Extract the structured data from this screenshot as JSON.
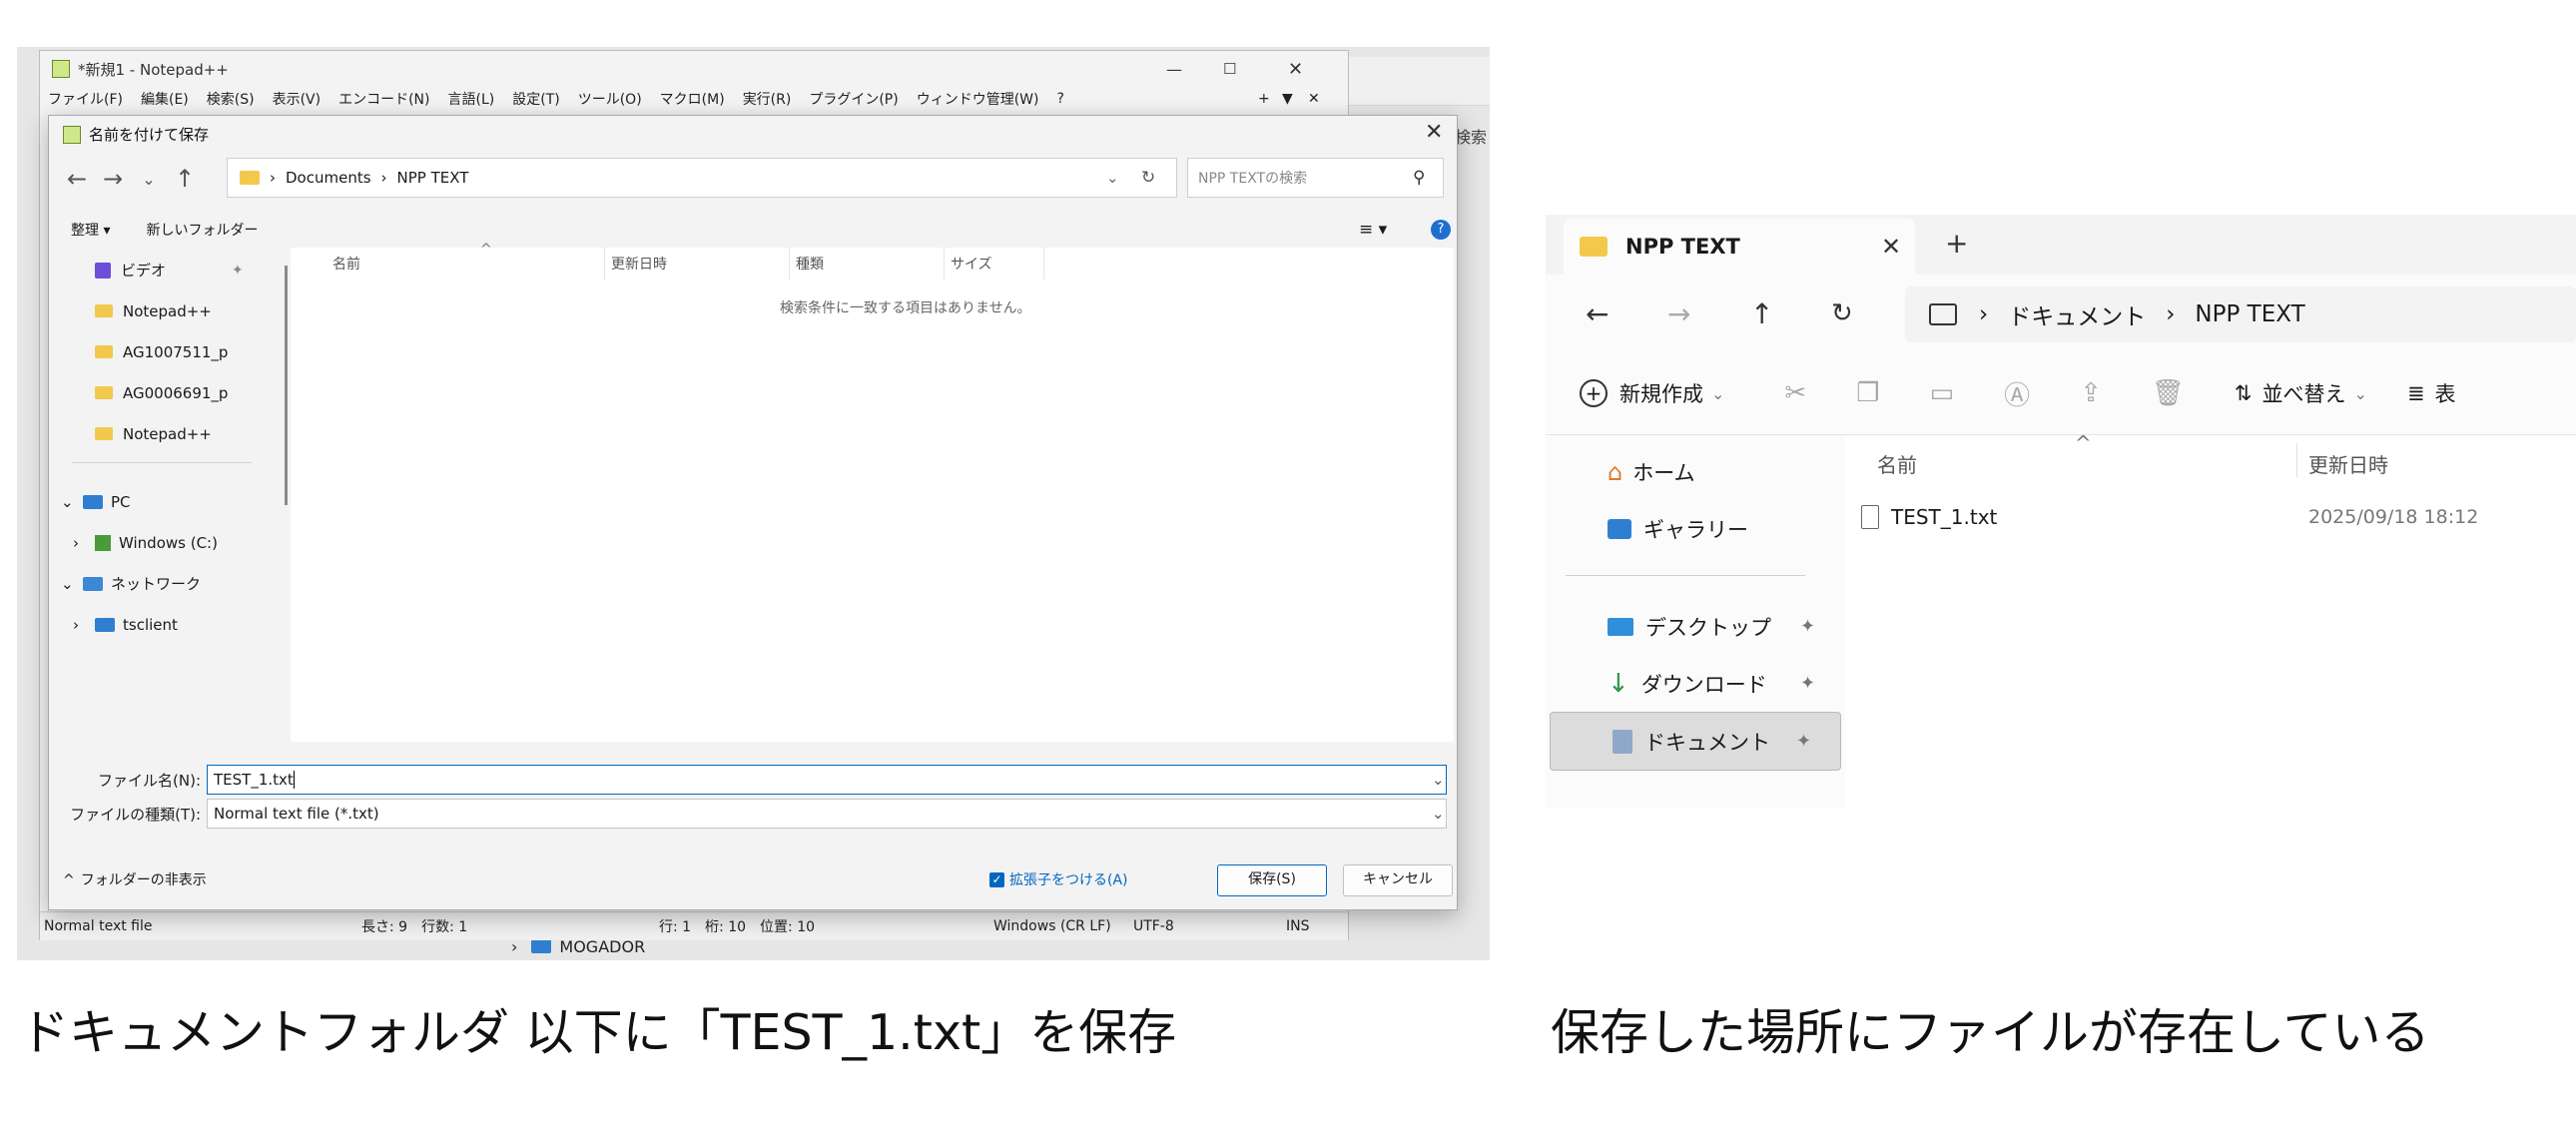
{
  "left": {
    "npp": {
      "title": "*新規1 - Notepad++",
      "menus": [
        "ファイル(F)",
        "編集(E)",
        "検索(S)",
        "表示(V)",
        "エンコード(N)",
        "言語(L)",
        "設定(T)",
        "ツール(O)",
        "マクロ(M)",
        "実行(R)",
        "プラグイン(P)",
        "ウィンドウ管理(W)",
        "?"
      ],
      "status": {
        "type": "Normal text file",
        "length": "長さ: 9　行数: 1",
        "position": "行: 1　桁: 10　位置: 10",
        "eol": "Windows (CR LF)",
        "encoding": "UTF-8",
        "mode": "INS"
      },
      "behind_search": "検索",
      "behind_taskbar_item": "MOGADOR"
    },
    "dialog": {
      "title": "名前を付けて保存",
      "breadcrumb": [
        "Documents",
        "NPP TEXT"
      ],
      "search_placeholder": "NPP TEXTの検索",
      "organize": "整理 ▾",
      "new_folder": "新しいフォルダー",
      "nav_items": [
        {
          "label": "ビデオ",
          "icon": "video-icon"
        },
        {
          "label": "Notepad++",
          "icon": "folder-icon"
        },
        {
          "label": "AG1007511_p",
          "icon": "folder-icon"
        },
        {
          "label": "AG0006691_p",
          "icon": "folder-icon"
        },
        {
          "label": "Notepad++",
          "icon": "folder-icon"
        }
      ],
      "tree": {
        "pc": "PC",
        "windows": "Windows (C:)",
        "network": "ネットワーク",
        "tsclient": "tsclient"
      },
      "columns": [
        "名前",
        "更新日時",
        "種類",
        "サイズ"
      ],
      "empty_message": "検索条件に一致する項目はありません。",
      "filename_label": "ファイル名(N):",
      "filename_value": "TEST_1.txt",
      "filetype_label": "ファイルの種類(T):",
      "filetype_value": "Normal text file (*.txt)",
      "hide_folders": "フォルダーの非表示",
      "extension_checkbox": "拡張子をつける(A)",
      "save_button": "保存(S)",
      "cancel_button": "キャンセル"
    }
  },
  "right": {
    "tab_title": "NPP TEXT",
    "breadcrumb": [
      "ドキュメント",
      "NPP TEXT"
    ],
    "toolbar": {
      "new": "新規作成",
      "sort": "並べ替え",
      "view": "表"
    },
    "nav_items": [
      {
        "label": "ホーム",
        "icon": "home-icon",
        "pinned": false
      },
      {
        "label": "ギャラリー",
        "icon": "gallery-icon",
        "pinned": false
      },
      {
        "label": "デスクトップ",
        "icon": "desktop-icon",
        "pinned": true
      },
      {
        "label": "ダウンロード",
        "icon": "download-icon",
        "pinned": true
      },
      {
        "label": "ドキュメント",
        "icon": "documents-icon",
        "pinned": true,
        "selected": true
      }
    ],
    "columns": [
      "名前",
      "更新日時"
    ],
    "files": [
      {
        "name": "TEST_1.txt",
        "modified": "2025/09/18 18:12"
      }
    ]
  },
  "captions": {
    "left": "ドキュメントフォルダ 以下に「TEST_1.txt」を保存",
    "right": "保存した場所にファイルが存在している"
  },
  "colors": {
    "accent": "#0067c0",
    "folder": "#f2c94c"
  }
}
